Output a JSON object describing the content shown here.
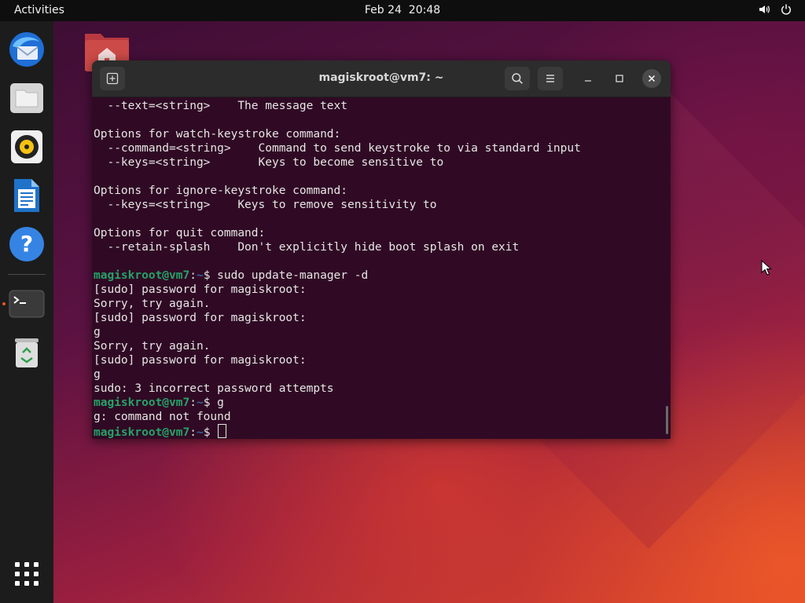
{
  "topbar": {
    "activities": "Activities",
    "date": "Feb 24",
    "time": "20:48",
    "icons": [
      "volume-icon",
      "power-icon"
    ]
  },
  "dock": {
    "items": [
      {
        "name": "thunderbird-icon"
      },
      {
        "name": "files-icon"
      },
      {
        "name": "rhythmbox-icon"
      },
      {
        "name": "libreoffice-writer-icon"
      },
      {
        "name": "help-icon"
      },
      {
        "name": "terminal-icon",
        "running": true
      },
      {
        "name": "trash-icon"
      }
    ],
    "app_grid_icon": "show-applications-icon"
  },
  "desktop": {
    "home_folder_icon": "home-folder-icon"
  },
  "terminal": {
    "title": "magiskroot@vm7: ~",
    "prompt_user": "magiskroot@vm7",
    "prompt_path": "~",
    "lines": [
      {
        "type": "text",
        "text": "  --text=<string>    The message text"
      },
      {
        "type": "text",
        "text": ""
      },
      {
        "type": "text",
        "text": "Options for watch-keystroke command:"
      },
      {
        "type": "text",
        "text": "  --command=<string>    Command to send keystroke to via standard input"
      },
      {
        "type": "text",
        "text": "  --keys=<string>       Keys to become sensitive to"
      },
      {
        "type": "text",
        "text": ""
      },
      {
        "type": "text",
        "text": "Options for ignore-keystroke command:"
      },
      {
        "type": "text",
        "text": "  --keys=<string>    Keys to remove sensitivity to"
      },
      {
        "type": "text",
        "text": ""
      },
      {
        "type": "text",
        "text": "Options for quit command:"
      },
      {
        "type": "text",
        "text": "  --retain-splash    Don't explicitly hide boot splash on exit"
      },
      {
        "type": "text",
        "text": ""
      },
      {
        "type": "prompt",
        "user": "magiskroot@vm7",
        "sep": ":",
        "path": "~",
        "cmd": "$ sudo update-manager -d"
      },
      {
        "type": "text",
        "text": "[sudo] password for magiskroot:"
      },
      {
        "type": "text",
        "text": "Sorry, try again."
      },
      {
        "type": "text",
        "text": "[sudo] password for magiskroot:"
      },
      {
        "type": "text",
        "text": "g"
      },
      {
        "type": "text",
        "text": "Sorry, try again."
      },
      {
        "type": "text",
        "text": "[sudo] password for magiskroot:"
      },
      {
        "type": "text",
        "text": "g"
      },
      {
        "type": "text",
        "text": "sudo: 3 incorrect password attempts"
      },
      {
        "type": "prompt",
        "user": "magiskroot@vm7",
        "sep": ":",
        "path": "~",
        "cmd": "$ g"
      },
      {
        "type": "text",
        "text": "g: command not found"
      },
      {
        "type": "prompt",
        "user": "magiskroot@vm7",
        "sep": ":",
        "path": "~",
        "cmd": "$ ",
        "cursor": true
      }
    ]
  }
}
